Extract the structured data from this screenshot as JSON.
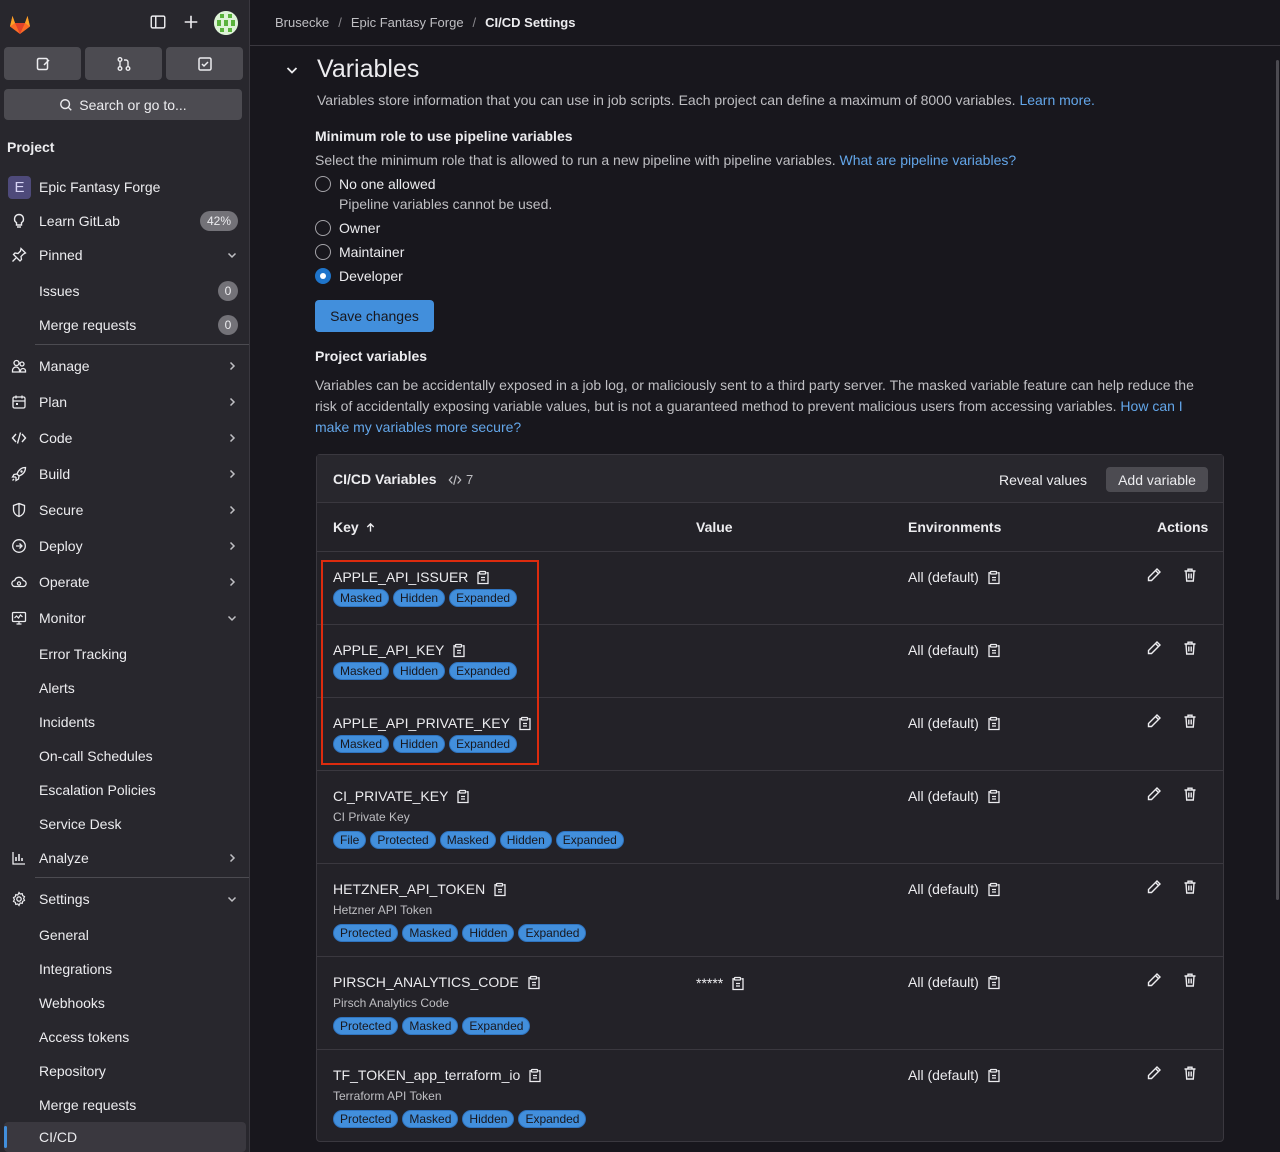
{
  "sidebar": {
    "search_label": "Search or go to...",
    "section_title": "Project",
    "project_initial": "E",
    "project_name": "Epic Fantasy Forge",
    "learn_label": "Learn GitLab",
    "learn_pct": "42%",
    "pinned_label": "Pinned",
    "issues_label": "Issues",
    "issues_count": "0",
    "mr_label": "Merge requests",
    "mr_count": "0",
    "manage": "Manage",
    "plan": "Plan",
    "code": "Code",
    "build": "Build",
    "secure": "Secure",
    "deploy": "Deploy",
    "operate": "Operate",
    "monitor": "Monitor",
    "monitor_items": [
      "Error Tracking",
      "Alerts",
      "Incidents",
      "On-call Schedules",
      "Escalation Policies",
      "Service Desk"
    ],
    "analyze": "Analyze",
    "settings": "Settings",
    "settings_items": [
      "General",
      "Integrations",
      "Webhooks",
      "Access tokens",
      "Repository",
      "Merge requests",
      "CI/CD"
    ]
  },
  "breadcrumb": {
    "group": "Brusecke",
    "project": "Epic Fantasy Forge",
    "current": "CI/CD Settings"
  },
  "variables_section": {
    "title": "Variables",
    "description": "Variables store information that you can use in job scripts. Each project can define a maximum of 8000 variables.",
    "learn_more": "Learn more.",
    "min_role_title": "Minimum role to use pipeline variables",
    "min_role_desc": "Select the minimum role that is allowed to run a new pipeline with pipeline variables.",
    "min_role_link": "What are pipeline variables?",
    "options": [
      {
        "label": "No one allowed",
        "help": "Pipeline variables cannot be used.",
        "checked": false
      },
      {
        "label": "Owner",
        "checked": false
      },
      {
        "label": "Maintainer",
        "checked": false
      },
      {
        "label": "Developer",
        "checked": true
      }
    ],
    "save_label": "Save changes",
    "project_vars_title": "Project variables",
    "project_vars_desc": "Variables can be accidentally exposed in a job log, or maliciously sent to a third party server. The masked variable feature can help reduce the risk of accidentally exposing variable values, but is not a guaranteed method to prevent malicious users from accessing variables.",
    "project_vars_link": "How can I make my variables more secure?"
  },
  "card": {
    "title": "CI/CD Variables",
    "count": "7",
    "reveal_label": "Reveal values",
    "add_label": "Add variable",
    "columns": {
      "key": "Key",
      "value": "Value",
      "environments": "Environments",
      "actions": "Actions"
    },
    "rows": [
      {
        "key": "APPLE_API_ISSUER",
        "description": "",
        "value": "",
        "env": "All (default)",
        "badges": [
          "Masked",
          "Hidden",
          "Expanded"
        ]
      },
      {
        "key": "APPLE_API_KEY",
        "description": "",
        "value": "",
        "env": "All (default)",
        "badges": [
          "Masked",
          "Hidden",
          "Expanded"
        ]
      },
      {
        "key": "APPLE_API_PRIVATE_KEY",
        "description": "",
        "value": "",
        "env": "All (default)",
        "badges": [
          "Masked",
          "Hidden",
          "Expanded"
        ]
      },
      {
        "key": "CI_PRIVATE_KEY",
        "description": "CI Private Key",
        "value": "",
        "env": "All (default)",
        "badges": [
          "File",
          "Protected",
          "Masked",
          "Hidden",
          "Expanded"
        ]
      },
      {
        "key": "HETZNER_API_TOKEN",
        "description": "Hetzner API Token",
        "value": "",
        "env": "All (default)",
        "badges": [
          "Protected",
          "Masked",
          "Hidden",
          "Expanded"
        ]
      },
      {
        "key": "PIRSCH_ANALYTICS_CODE",
        "description": "Pirsch Analytics Code",
        "value": "*****",
        "env": "All (default)",
        "badges": [
          "Protected",
          "Masked",
          "Expanded"
        ]
      },
      {
        "key": "TF_TOKEN_app_terraform_io",
        "description": "Terraform API Token",
        "value": "",
        "env": "All (default)",
        "badges": [
          "Protected",
          "Masked",
          "Hidden",
          "Expanded"
        ]
      }
    ]
  },
  "colors": {
    "accent": "#428fdc",
    "highlight": "#dd2b0e",
    "background": "#18171d",
    "sidebar": "#28272d"
  }
}
